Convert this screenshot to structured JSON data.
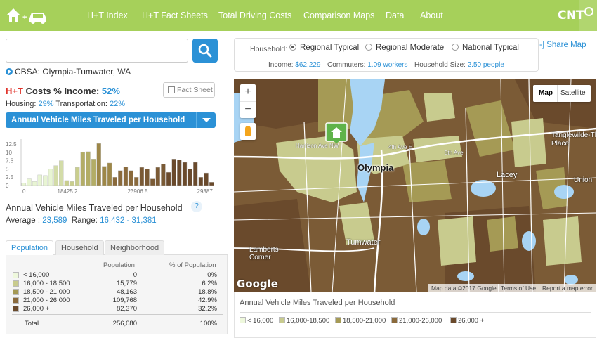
{
  "nav": {
    "items": [
      "H+T Index",
      "H+T Fact Sheets",
      "Total Driving Costs",
      "Comparison Maps",
      "Data",
      "About"
    ],
    "brand": "CNT"
  },
  "search": {
    "placeholder": "",
    "value": ""
  },
  "cbsa": {
    "label": "CBSA: Olympia-Tumwater, WA"
  },
  "ht": {
    "prefix": "H+T",
    "title": "Costs % Income:",
    "value": "52%",
    "fact_sheet": "Fact Sheet",
    "housing_label": "Housing:",
    "housing_value": "29%",
    "transport_label": "Transportation:",
    "transport_value": "22%"
  },
  "metric_select": {
    "selected": "Annual Vehicle Miles Traveled per Household"
  },
  "chart_data": {
    "type": "bar",
    "title": "",
    "ytick_labels": [
      "12.5",
      "10",
      "7.5",
      "5",
      "2.5",
      "0"
    ],
    "ylim": [
      0,
      14
    ],
    "xtick_labels": [
      "0",
      "18425.2",
      "23906.5",
      "29387."
    ],
    "values": [
      0.8,
      2,
      1.2,
      3.2,
      3,
      5,
      6,
      7.5,
      1.5,
      1.2,
      5.5,
      10,
      10.2,
      8,
      12.7,
      5.8,
      6.8,
      2.5,
      4.5,
      5.6,
      4.5,
      2.5,
      5.5,
      5,
      2,
      5.5,
      6.5,
      4,
      8,
      7.8,
      7,
      5,
      7,
      2.5,
      3.8,
      1
    ],
    "colors": [
      "#e8f5d3",
      "#e8f5d3",
      "#e8f5d3",
      "#e8f5d3",
      "#e8f5d3",
      "#e8f5d3",
      "#d3dca8",
      "#d3dca8",
      "#c9ce8d",
      "#c9ce8d",
      "#c9ce8d",
      "#b3ad66",
      "#b3ad66",
      "#b3ad66",
      "#9d8748",
      "#9d8748",
      "#9d8748",
      "#8a6a3c",
      "#8a6a3c",
      "#8a6a3c",
      "#8a6a3c",
      "#8a6a3c",
      "#7a5a35",
      "#7a5a35",
      "#7a5a35",
      "#7a5a35",
      "#7a5a35",
      "#6a4a2c",
      "#6a4a2c",
      "#6a4a2c",
      "#6a4a2c",
      "#6a4a2c",
      "#6a4a2c",
      "#6a4a2c",
      "#6a4a2c",
      "#6a4a2c"
    ],
    "grid": false
  },
  "metric": {
    "title": "Annual Vehicle Miles Traveled per Household",
    "help": "?",
    "average_label": "Average :",
    "average_value": "23,589",
    "range_label": "Range:",
    "range_value": "16,432 - 31,381"
  },
  "tabs": [
    "Population",
    "Household",
    "Neighborhood"
  ],
  "table": {
    "headers": [
      "Population",
      "% of Population"
    ],
    "rows": [
      {
        "label": "< 16,000",
        "count": "0",
        "pct": "0%",
        "color": "#eef8dc"
      },
      {
        "label": "16,000 - 18,500",
        "count": "15,779",
        "pct": "6.2%",
        "color": "#c8cb8e"
      },
      {
        "label": "18,500 - 21,000",
        "count": "48,163",
        "pct": "18.8%",
        "color": "#a59a55"
      },
      {
        "label": "21,000 - 26,000",
        "count": "109,768",
        "pct": "42.9%",
        "color": "#8a6a3c"
      },
      {
        "label": "26,000 +",
        "count": "82,370",
        "pct": "32.2%",
        "color": "#6a4a2c"
      }
    ],
    "total_label": "Total",
    "total_count": "256,080",
    "total_pct": "100%"
  },
  "household": {
    "label": "Household:",
    "options": [
      "Regional Typical",
      "Regional Moderate",
      "National Typical"
    ],
    "selected": "Regional Typical",
    "income_label": "Income:",
    "income_value": "$62,229",
    "commuters_label": "Commuters:",
    "commuters_value": "1.09 workers",
    "size_label": "Household Size:",
    "size_value": "2.50 people"
  },
  "share": "-] Share Map",
  "map": {
    "type_map": "Map",
    "type_satellite": "Satellite",
    "zoom_in": "+",
    "zoom_out": "−",
    "google": "Google",
    "footer_data": "Map data ©2017 Google",
    "footer_terms": "Terms of Use",
    "footer_report": "Report a map error",
    "labels": {
      "olympia": "Olympia",
      "tumwater": "Tumwater",
      "lacey": "Lacey",
      "lamberts": "Lamberts\nCorner",
      "tanglewilde": "Tanglewilde-Th\nPlace",
      "union": "Union",
      "harrison": "Harrison Ave NW",
      "fourth": "4th Ave E",
      "fifth": "5th Ave"
    }
  },
  "legend": {
    "title": "Annual Vehicle Miles Traveled per Household",
    "items": [
      {
        "label": "< 16,000",
        "color": "#eef8dc"
      },
      {
        "label": "16,000-18,500",
        "color": "#c8cb8e"
      },
      {
        "label": "18,500-21,000",
        "color": "#a59a55"
      },
      {
        "label": "21,000-26,000",
        "color": "#8a6a3c"
      },
      {
        "label": "26,000 +",
        "color": "#6a4a2c"
      }
    ]
  }
}
